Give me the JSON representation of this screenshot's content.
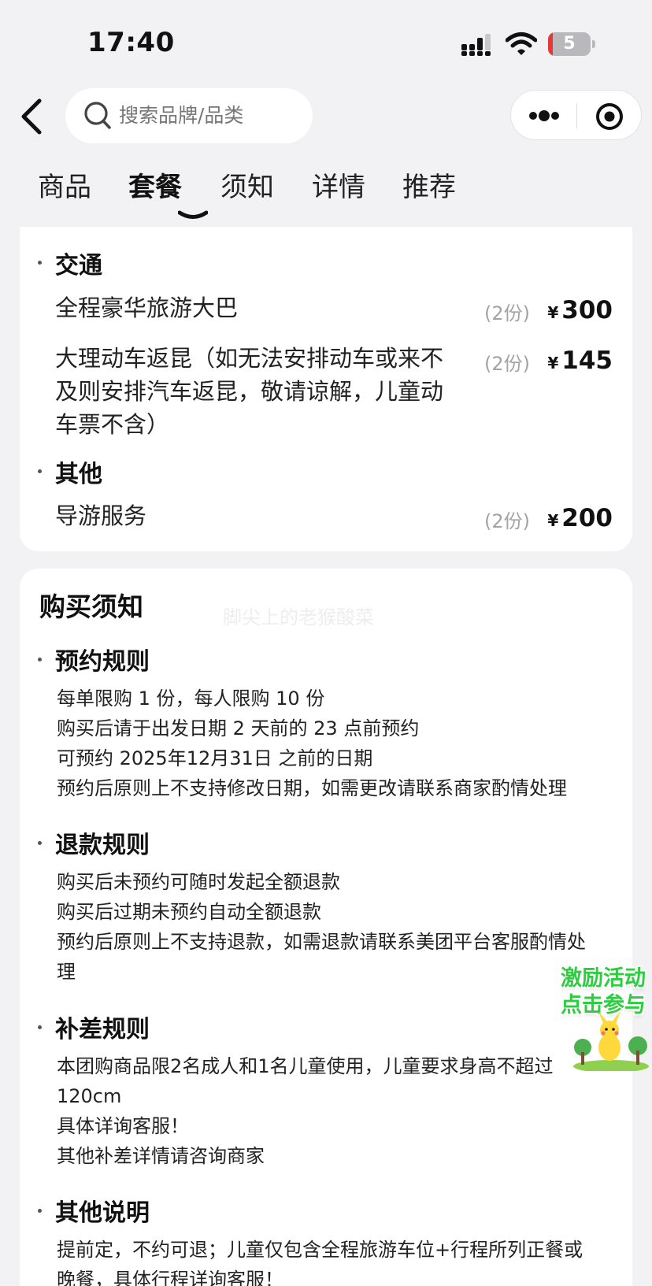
{
  "status_bar": {
    "time": "17:40",
    "battery": "5"
  },
  "search": {
    "placeholder": "搜索品牌/品类"
  },
  "tabs": [
    "商品",
    "套餐",
    "须知",
    "详情",
    "推荐"
  ],
  "active_tab": "套餐",
  "package": {
    "sections": [
      {
        "title": "交通",
        "items": [
          {
            "name": "全程豪华旅游大巴",
            "qty": "(2份)",
            "currency": "¥",
            "price": "300"
          },
          {
            "name_lines": [
              "大理动车返昆（如无法安排动车或来不",
              "及则安排汽车返昆，敬请谅解，儿童动",
              "车票不含）"
            ],
            "qty": "(2份)",
            "currency": "¥",
            "price": "145"
          }
        ]
      },
      {
        "title": "其他",
        "items": [
          {
            "name": "导游服务",
            "qty": "(2份)",
            "currency": "¥",
            "price": "200"
          }
        ]
      }
    ]
  },
  "notice": {
    "title": "购买须知",
    "watermark": "脚尖上的老猴酸菜",
    "rules": [
      {
        "title": "预约规则",
        "lines": [
          "每单限购 1 份，每人限购 10 份",
          "购买后请于出发日期 2 天前的 23 点前预约",
          "可预约 2025年12月31日 之前的日期",
          "预约后原则上不支持修改日期，如需更改请联系商家酌情处理"
        ]
      },
      {
        "title": "退款规则",
        "lines": [
          "购买后未预约可随时发起全额退款",
          "购买后过期未预约自动全额退款",
          "预约后原则上不支持退款，如需退款请联系美团平台客服酌情处",
          "理"
        ]
      },
      {
        "title": "补差规则",
        "lines": [
          "本团购商品限2名成人和1名儿童使用，儿童要求身高不超过",
          "120cm",
          "具体详询客服！",
          "其他补差详情请咨询商家"
        ]
      },
      {
        "title": "其他说明",
        "lines": [
          "提前定，不约可退；儿童仅包含全程旅游车位+行程所列正餐或",
          "晚餐，具体行程详询客服！"
        ]
      }
    ]
  },
  "promo": {
    "line1": "激励活动",
    "line2": "点击参与"
  },
  "colors": {
    "accent_green": "#2ecc40",
    "battery_low": "#e53935"
  }
}
